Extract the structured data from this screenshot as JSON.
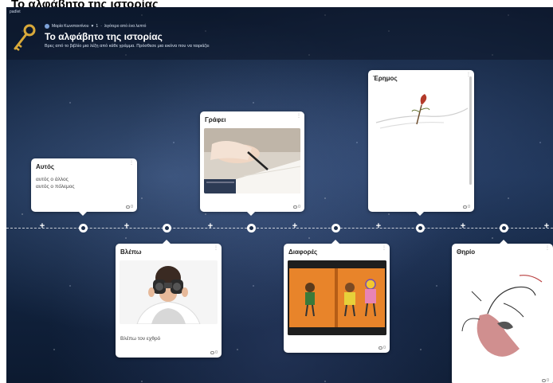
{
  "page_title": "Το αλφάβητο της ιστορίας",
  "header": {
    "brand": "padlet",
    "author": "Μαρία Κωνσταντίνου",
    "likes": "1",
    "separator": "·",
    "edited": "λιγότερο από ένα λεπτό",
    "title": "Το αλφάβητο της ιστορίας",
    "description": "Βρες από το βιβλίο μια λέξη από κάθε γράμμα. Πρόσθεσε μια εικόνα που να ταιριάζει"
  },
  "cards": [
    {
      "title": "Αυτός",
      "lines": [
        "αυτός ο άλλος",
        "αυτός ο πόλεμος"
      ],
      "comments": "0"
    },
    {
      "title": "Βλέπω",
      "caption": "Βλέπω τον εχθρό",
      "comments": "0"
    },
    {
      "title": "Γράφει",
      "comments": "0"
    },
    {
      "title": "Διαφορές",
      "comments": "0"
    },
    {
      "title": "Έρημος",
      "comments": "0"
    },
    {
      "title": "Θηρίο",
      "comments": "0"
    }
  ],
  "colors": {
    "header_bg": "#0c1628",
    "card_bg": "#ffffff",
    "node_dot": "#1b2d4a"
  }
}
